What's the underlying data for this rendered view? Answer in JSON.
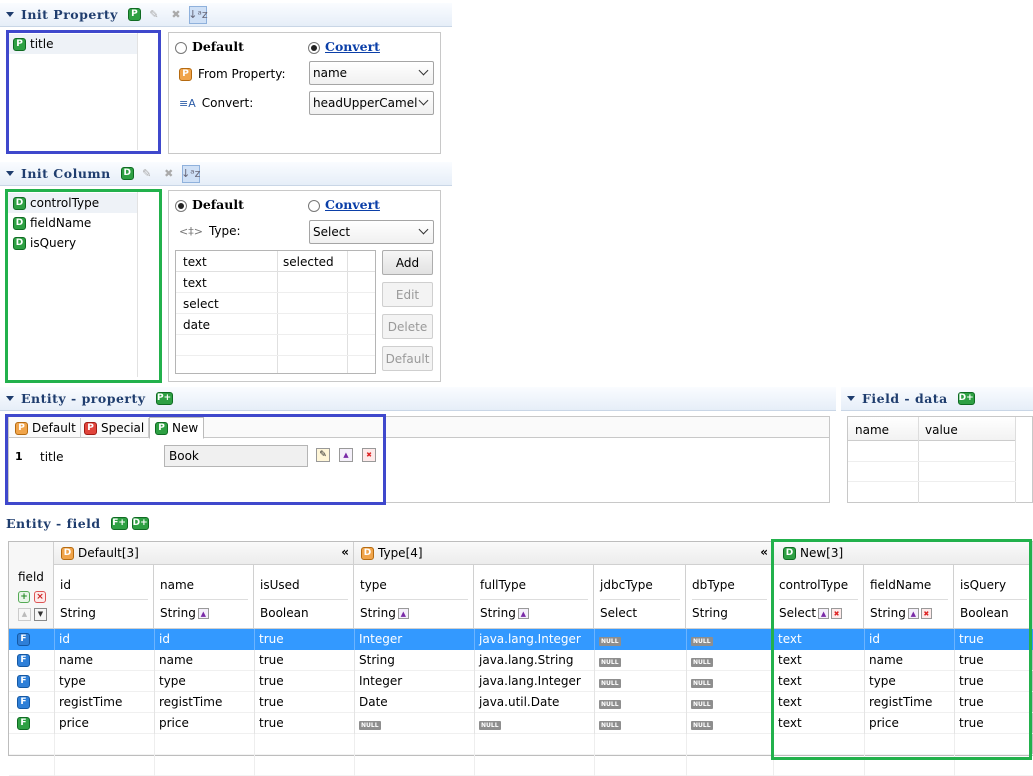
{
  "init_property": {
    "title": "Init Property",
    "items": [
      "title"
    ],
    "radio_default": "Default",
    "radio_convert": "Convert",
    "from_property_label": "From Property:",
    "from_property_value": "name",
    "convert_label": "Convert:",
    "convert_value": "headUpperCamel"
  },
  "init_column": {
    "title": "Init Column",
    "items": [
      "controlType",
      "fieldName",
      "isQuery"
    ],
    "radio_default": "Default",
    "radio_convert": "Convert",
    "type_label": "Type:",
    "type_value": "Select",
    "table_headers": [
      "text",
      "selected"
    ],
    "table_rows": [
      "text",
      "select",
      "date"
    ],
    "buttons": [
      "Add",
      "Edit",
      "Delete",
      "Default"
    ]
  },
  "entity_property": {
    "title": "Entity - property",
    "tabs": [
      "Default",
      "Special",
      "New"
    ],
    "row_index": "1",
    "row_name": "title",
    "row_value": "Book"
  },
  "field_data": {
    "title": "Field - data",
    "headers": [
      "name",
      "value"
    ]
  },
  "entity_field": {
    "title": "Entity - field",
    "left_header": "field",
    "groups": [
      "Default[3]",
      "Type[4]",
      "New[3]"
    ],
    "columns": [
      {
        "name": "id",
        "type": "String"
      },
      {
        "name": "name",
        "type": "String"
      },
      {
        "name": "isUsed",
        "type": "Boolean"
      },
      {
        "name": "type",
        "type": "String"
      },
      {
        "name": "fullType",
        "type": "String"
      },
      {
        "name": "jdbcType",
        "type": "Select"
      },
      {
        "name": "dbType",
        "type": "String"
      },
      {
        "name": "controlType",
        "type": "Select"
      },
      {
        "name": "fieldName",
        "type": "String"
      },
      {
        "name": "isQuery",
        "type": "Boolean"
      }
    ],
    "null_label": "NULL",
    "rows": [
      [
        "id",
        "id",
        "true",
        "Integer",
        "java.lang.Integer",
        "NULL",
        "NULL",
        "text",
        "id",
        "true"
      ],
      [
        "name",
        "name",
        "true",
        "String",
        "java.lang.String",
        "NULL",
        "NULL",
        "text",
        "name",
        "true"
      ],
      [
        "type",
        "type",
        "true",
        "Integer",
        "java.lang.Integer",
        "NULL",
        "NULL",
        "text",
        "type",
        "true"
      ],
      [
        "registTime",
        "registTime",
        "true",
        "Date",
        "java.util.Date",
        "NULL",
        "NULL",
        "text",
        "registTime",
        "true"
      ],
      [
        "price",
        "price",
        "true",
        "NULL",
        "NULL",
        "NULL",
        "NULL",
        "text",
        "price",
        "true"
      ]
    ],
    "row_icons": [
      "B",
      "B",
      "B",
      "B",
      "G"
    ]
  },
  "colors": {
    "highlight_blue": "#3f48cc",
    "highlight_green": "#22b14c",
    "selection": "#3399ff"
  }
}
